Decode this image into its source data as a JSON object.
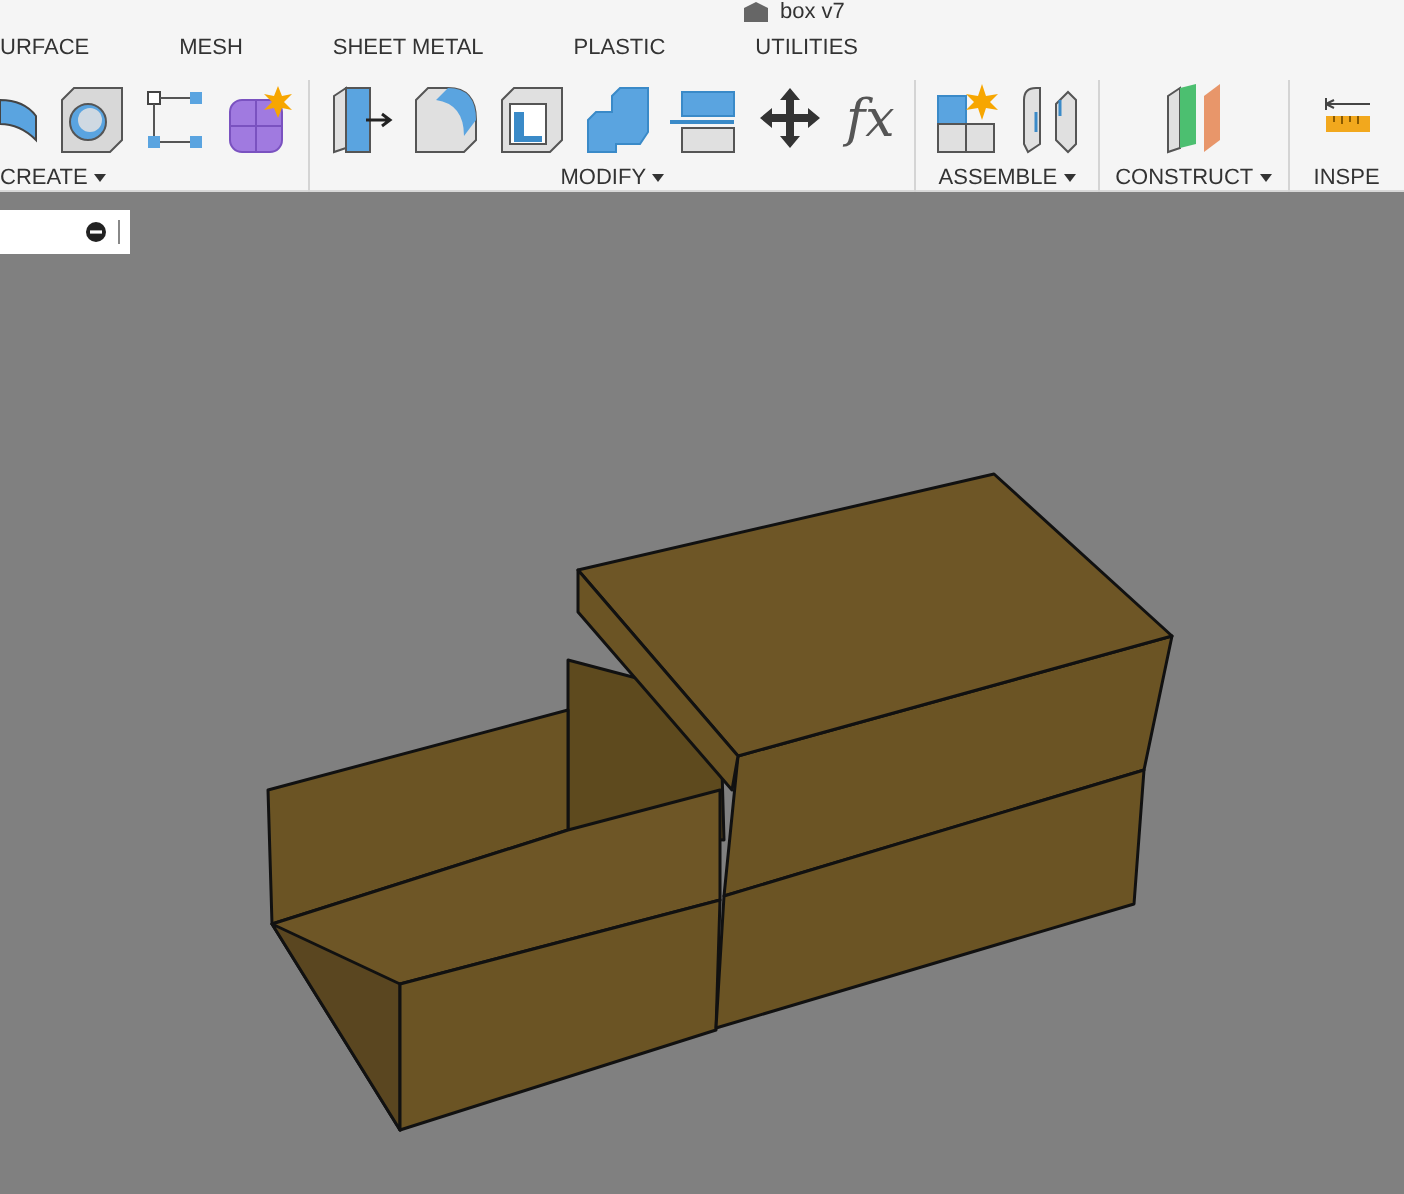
{
  "window": {
    "title": "box v7"
  },
  "tabs": [
    {
      "label": "URFACE"
    },
    {
      "label": "MESH"
    },
    {
      "label": "SHEET METAL"
    },
    {
      "label": "PLASTIC"
    },
    {
      "label": "UTILITIES"
    }
  ],
  "groups": [
    {
      "kind": "create",
      "label": "CREATE"
    },
    {
      "kind": "modify",
      "label": "MODIFY",
      "function_glyph": "fx"
    },
    {
      "kind": "assemble",
      "label": "ASSEMBLE"
    },
    {
      "kind": "construct",
      "label": "CONSTRUCT"
    },
    {
      "kind": "inspect",
      "label": "INSPE"
    }
  ]
}
